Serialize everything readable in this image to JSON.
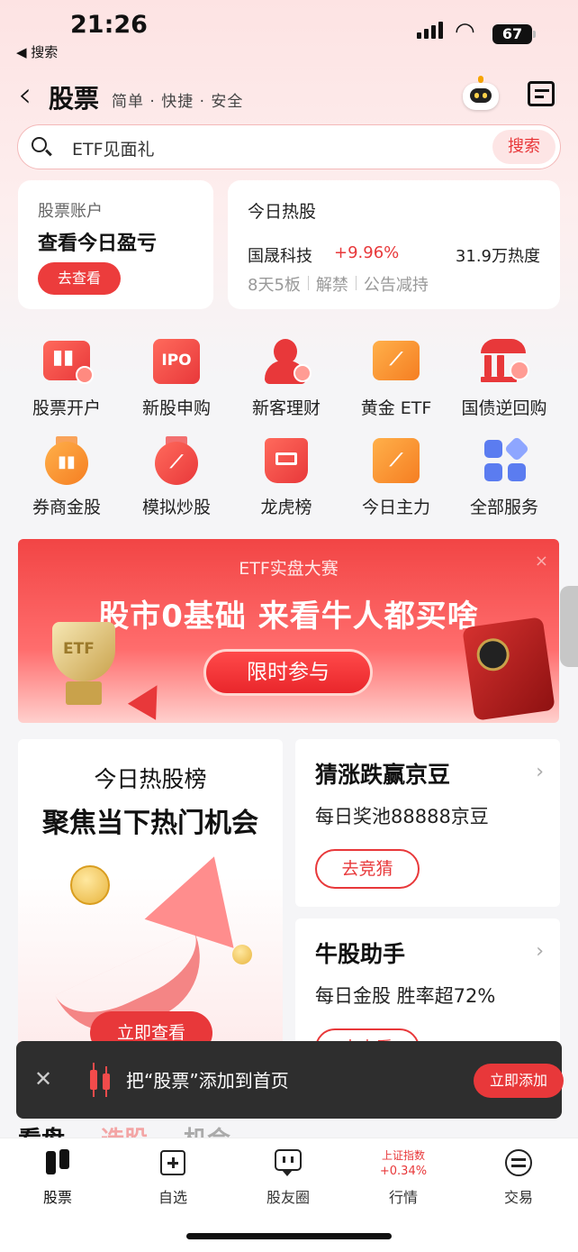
{
  "status_bar": {
    "time": "21:26",
    "back_label": "◀ 搜索",
    "battery": "67"
  },
  "header": {
    "back_icon": "‹",
    "title": "股票",
    "subtitle": "简单 · 快捷 · 安全"
  },
  "search": {
    "placeholder": "ETF见面礼",
    "button": "搜索"
  },
  "account_card": {
    "label": "股票账户",
    "title": "查看今日盈亏",
    "button": "去查看"
  },
  "hot_stock_card": {
    "title": "今日热股",
    "stock_name": "国晟科技",
    "change": "+9.96%",
    "heat": "31.9万热度",
    "tags": [
      "8天5板",
      "解禁",
      "公告减持"
    ]
  },
  "services": [
    {
      "label": "股票开户",
      "icon": "candlestick-plus-icon"
    },
    {
      "label": "新股申购",
      "icon": "ipo-calendar-icon"
    },
    {
      "label": "新客理财",
      "icon": "person-coin-icon"
    },
    {
      "label": "黄金 ETF",
      "icon": "gold-chart-icon"
    },
    {
      "label": "国债逆回购",
      "icon": "bank-icon"
    },
    {
      "label": "券商金股",
      "icon": "medal-candle-icon"
    },
    {
      "label": "模拟炒股",
      "icon": "medal-trend-icon"
    },
    {
      "label": "龙虎榜",
      "icon": "crown-badge-icon"
    },
    {
      "label": "今日主力",
      "icon": "calendar-trend-icon"
    },
    {
      "label": "全部服务",
      "icon": "grid-icon"
    }
  ],
  "banner": {
    "subtitle": "ETF实盘大赛",
    "title": "股市0基础 来看牛人都买啥",
    "button": "限时参与",
    "cup_text": "ETF",
    "close": "×"
  },
  "hot_rank": {
    "line1": "今日热股榜",
    "line2": "聚焦当下热门机会",
    "button": "立即查看"
  },
  "guess_card": {
    "title": "猜涨跌赢京豆",
    "desc": "每日奖池88888京豆",
    "button": "去竞猜",
    "chevron": "›"
  },
  "bull_card": {
    "title": "牛股助手",
    "desc": "每日金股 胜率超72%",
    "button": "去查看",
    "chevron": "›"
  },
  "section_tabs": [
    "看盘",
    "选股",
    "机会"
  ],
  "toast": {
    "close": "✕",
    "message": "把“股票”添加到首页",
    "button": "立即添加"
  },
  "tabbar": {
    "items": [
      "股票",
      "自选",
      "股友圈",
      "行情",
      "交易"
    ],
    "index_name": "上证指数",
    "index_change": "+0.34%"
  },
  "colors": {
    "accent": "#e8383a",
    "toast_bg": "#2e2e2e"
  }
}
